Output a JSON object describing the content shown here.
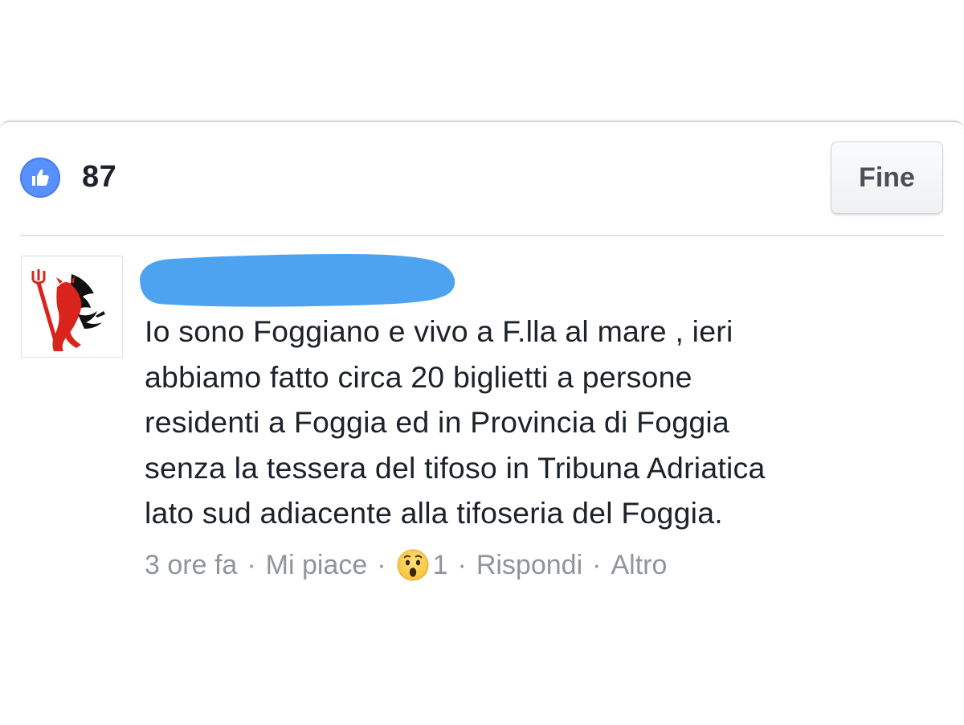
{
  "reactions": {
    "like_icon": "like-thumbs-up-icon",
    "like_count": "87",
    "accent_color": "#5890ff"
  },
  "header": {
    "done_label": "Fine"
  },
  "comment": {
    "avatar_icon": "red-devil-mascot-icon",
    "author_name_redacted": true,
    "text_lines": [
      "Io sono Foggiano e vivo a F.lla al mare , ieri",
      "abbiamo fatto circa 20 biglietti a persone",
      "residenti a Foggia ed in Provincia di Foggia",
      "senza la tessera del tifoso in Tribuna Adriatica",
      "lato sud adiacente alla tifoseria del Foggia."
    ],
    "meta": {
      "time": "3 ore fa",
      "like_label": "Mi piace",
      "reaction_icon": "wow-emoji-icon",
      "reaction_count": "1",
      "reply_label": "Rispondi",
      "more_label": "Altro",
      "separator": "·"
    }
  }
}
